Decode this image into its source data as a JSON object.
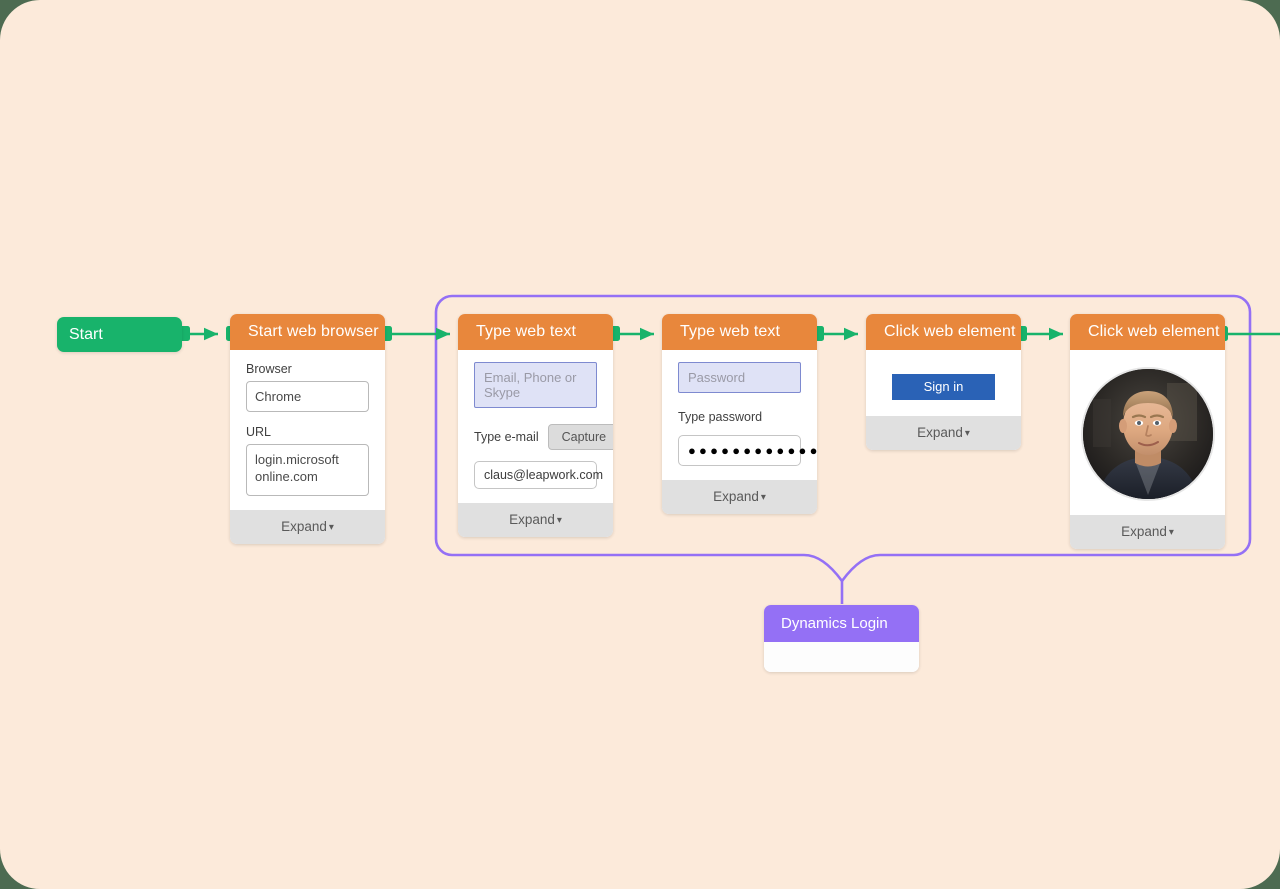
{
  "canvas": {
    "background": "#fceada",
    "outer_background": "#4d6b51",
    "accent_orange": "#e8873c",
    "accent_green": "#18b36b",
    "accent_purple": "#9470f5"
  },
  "start_node": {
    "label": "Start"
  },
  "nodes": [
    {
      "id": "start-web-browser",
      "title": "Start web browser",
      "fields": [
        {
          "label": "Browser",
          "value": "Chrome"
        },
        {
          "label": "URL",
          "value": "login.microsoft online.com"
        }
      ],
      "footer": "Expand"
    },
    {
      "id": "type-web-text-email",
      "title": "Type web text",
      "captured_placeholder": "Email, Phone or Skype",
      "capture_label": "Type e-mail",
      "capture_button": "Capture",
      "value": "claus@leapwork.com",
      "footer": "Expand"
    },
    {
      "id": "type-web-text-password",
      "title": "Type web text",
      "captured_placeholder": "Password",
      "capture_label": "Type password",
      "value": "●●●●●●●●●●●●●",
      "footer": "Expand"
    },
    {
      "id": "click-web-element-signin",
      "title": "Click web element",
      "captured_button": "Sign in",
      "footer": "Expand"
    },
    {
      "id": "click-web-element-avatar",
      "title": "Click web element",
      "captured_image": "user-avatar-photo",
      "footer": "Expand"
    }
  ],
  "group": {
    "label": "Dynamics Login",
    "border_color": "#9470f5"
  },
  "icons": {
    "expand_caret": "chevron-down-icon",
    "connector_arrow": "arrow-right-icon",
    "connector_port": "connection-port-icon"
  }
}
